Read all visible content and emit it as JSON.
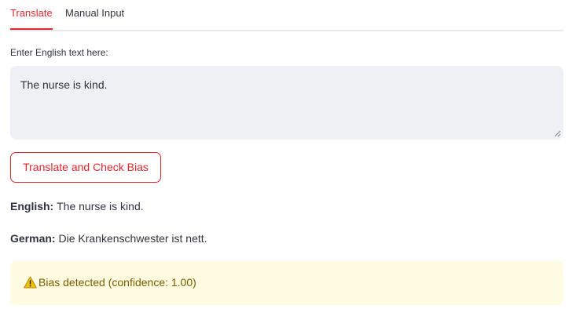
{
  "tabs": [
    {
      "label": "Translate",
      "active": true
    },
    {
      "label": "Manual Input",
      "active": false
    }
  ],
  "input": {
    "label": "Enter English text here:",
    "value": "The nurse is kind."
  },
  "action_button": {
    "label": "Translate and Check Bias"
  },
  "results": {
    "english_label": "English:",
    "english_text": "The nurse is kind.",
    "german_label": "German:",
    "german_text": "Die Krankenschwester ist nett."
  },
  "alert": {
    "icon": "warning-icon",
    "text": "Bias detected (confidence: 1.00)"
  },
  "colors": {
    "accent": "#e0282e",
    "text": "#31333f",
    "input_background": "#eff0f4",
    "warning_background": "#fffbe0",
    "warning_text": "#7a5c00"
  }
}
